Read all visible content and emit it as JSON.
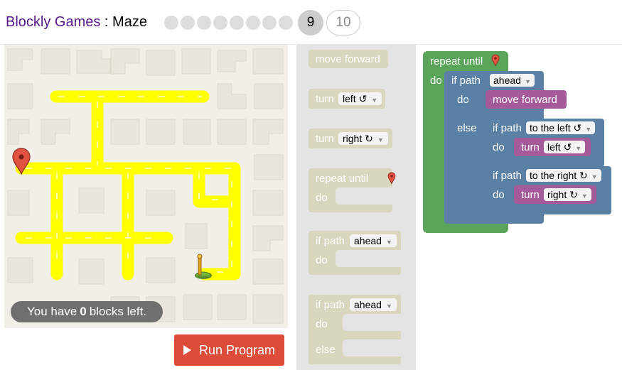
{
  "header": {
    "app_name": "Blockly Games",
    "separator": " : ",
    "game_name": "Maze",
    "levels": {
      "completed_dots": 8,
      "current": "9",
      "next": "10"
    }
  },
  "maze": {
    "blocks_left_prefix": "You have",
    "blocks_left_count": "0",
    "blocks_left_suffix": "blocks left."
  },
  "run_button": {
    "label": "Run Program"
  },
  "toolbox": {
    "move_forward": "move forward",
    "turn_left": {
      "label": "turn",
      "value": "left ↺"
    },
    "turn_right": {
      "label": "turn",
      "value": "right ↻"
    },
    "repeat_until": {
      "label": "repeat until",
      "do": "do"
    },
    "if_path": {
      "label": "if path",
      "value": "ahead",
      "do": "do"
    },
    "if_else": {
      "label": "if path",
      "value": "ahead",
      "do": "do",
      "else": "else"
    }
  },
  "workspace": {
    "repeat_until": "repeat until",
    "repeat_do": "do",
    "if_else_label": "if path",
    "if_else_value": "ahead",
    "if_else_do": "do",
    "move_forward": "move forward",
    "else": "else",
    "if_left_label": "if path",
    "if_left_value": "to the left ↺",
    "if_left_do": "do",
    "turn_left_label": "turn",
    "turn_left_value": "left ↺",
    "if_right_label": "if path",
    "if_right_value": "to the right ↻",
    "if_right_do": "do",
    "turn_right_label": "turn",
    "turn_right_value": "right ↻"
  },
  "colors": {
    "loop_block": "#5ba55b",
    "logic_block": "#5b80a5",
    "action_block": "#a55b99",
    "toolbox_block": "#d8d7bd",
    "maze_path": "#ffff00",
    "run_button": "#dd4b39"
  }
}
